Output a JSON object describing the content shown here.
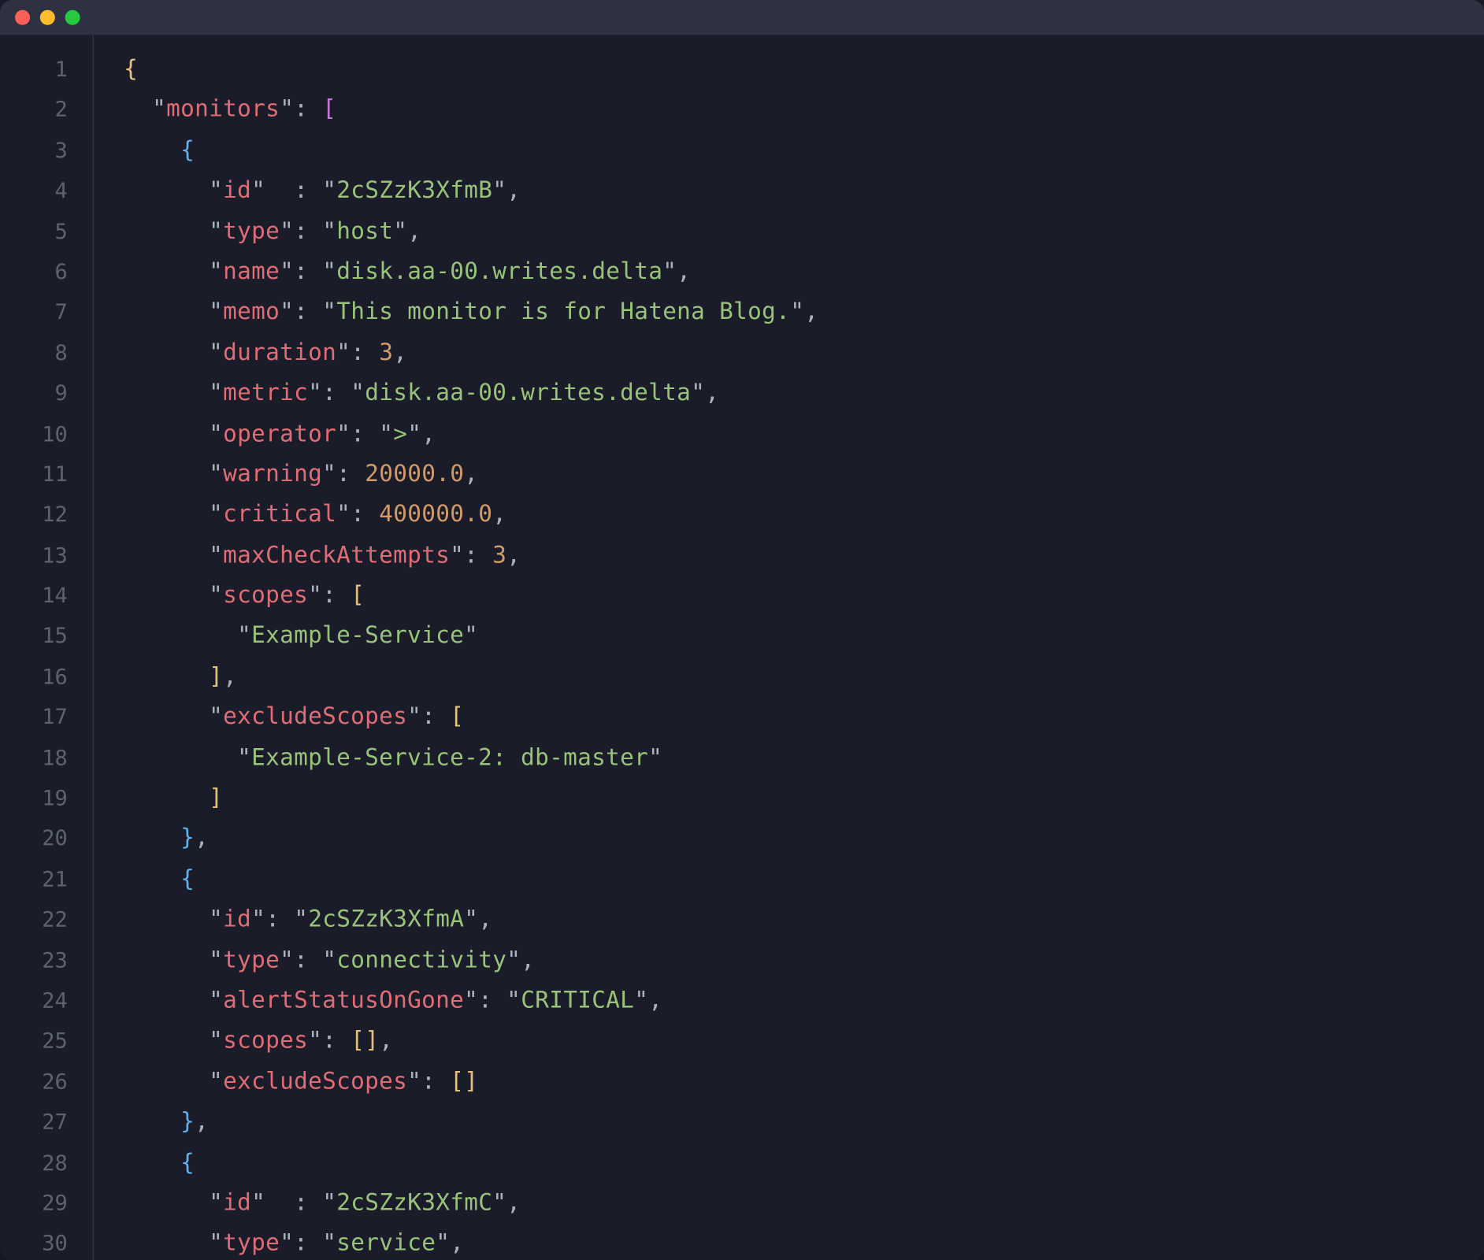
{
  "window": {
    "traffic": [
      "close",
      "minimize",
      "zoom"
    ]
  },
  "editor": {
    "lineStart": 1,
    "lineCount": 30
  },
  "tok": {
    "l1": [
      [
        "b1",
        "{"
      ]
    ],
    "l2": [
      [
        "p",
        "  "
      ],
      [
        "p",
        "\""
      ],
      [
        "k",
        "monitors"
      ],
      [
        "p",
        "\""
      ],
      [
        "p",
        ": "
      ],
      [
        "br",
        "["
      ]
    ],
    "l3": [
      [
        "p",
        "    "
      ],
      [
        "b2",
        "{"
      ]
    ],
    "l4": [
      [
        "p",
        "      "
      ],
      [
        "p",
        "\""
      ],
      [
        "k",
        "id"
      ],
      [
        "p",
        "\""
      ],
      [
        "p",
        "  : "
      ],
      [
        "p",
        "\""
      ],
      [
        "s",
        "2cSZzK3XfmB"
      ],
      [
        "p",
        "\""
      ],
      [
        "p",
        ","
      ]
    ],
    "l5": [
      [
        "p",
        "      "
      ],
      [
        "p",
        "\""
      ],
      [
        "k",
        "type"
      ],
      [
        "p",
        "\""
      ],
      [
        "p",
        ": "
      ],
      [
        "p",
        "\""
      ],
      [
        "s",
        "host"
      ],
      [
        "p",
        "\""
      ],
      [
        "p",
        ","
      ]
    ],
    "l6": [
      [
        "p",
        "      "
      ],
      [
        "p",
        "\""
      ],
      [
        "k",
        "name"
      ],
      [
        "p",
        "\""
      ],
      [
        "p",
        ": "
      ],
      [
        "p",
        "\""
      ],
      [
        "s",
        "disk.aa-00.writes.delta"
      ],
      [
        "p",
        "\""
      ],
      [
        "p",
        ","
      ]
    ],
    "l7": [
      [
        "p",
        "      "
      ],
      [
        "p",
        "\""
      ],
      [
        "k",
        "memo"
      ],
      [
        "p",
        "\""
      ],
      [
        "p",
        ": "
      ],
      [
        "p",
        "\""
      ],
      [
        "s",
        "This monitor is for Hatena Blog."
      ],
      [
        "p",
        "\""
      ],
      [
        "p",
        ","
      ]
    ],
    "l8": [
      [
        "p",
        "      "
      ],
      [
        "p",
        "\""
      ],
      [
        "k",
        "duration"
      ],
      [
        "p",
        "\""
      ],
      [
        "p",
        ": "
      ],
      [
        "n",
        "3"
      ],
      [
        "p",
        ","
      ]
    ],
    "l9": [
      [
        "p",
        "      "
      ],
      [
        "p",
        "\""
      ],
      [
        "k",
        "metric"
      ],
      [
        "p",
        "\""
      ],
      [
        "p",
        ": "
      ],
      [
        "p",
        "\""
      ],
      [
        "s",
        "disk.aa-00.writes.delta"
      ],
      [
        "p",
        "\""
      ],
      [
        "p",
        ","
      ]
    ],
    "l10": [
      [
        "p",
        "      "
      ],
      [
        "p",
        "\""
      ],
      [
        "k",
        "operator"
      ],
      [
        "p",
        "\""
      ],
      [
        "p",
        ": "
      ],
      [
        "p",
        "\""
      ],
      [
        "s",
        ">"
      ],
      [
        "p",
        "\""
      ],
      [
        "p",
        ","
      ]
    ],
    "l11": [
      [
        "p",
        "      "
      ],
      [
        "p",
        "\""
      ],
      [
        "k",
        "warning"
      ],
      [
        "p",
        "\""
      ],
      [
        "p",
        ": "
      ],
      [
        "n",
        "20000.0"
      ],
      [
        "p",
        ","
      ]
    ],
    "l12": [
      [
        "p",
        "      "
      ],
      [
        "p",
        "\""
      ],
      [
        "k",
        "critical"
      ],
      [
        "p",
        "\""
      ],
      [
        "p",
        ": "
      ],
      [
        "n",
        "400000.0"
      ],
      [
        "p",
        ","
      ]
    ],
    "l13": [
      [
        "p",
        "      "
      ],
      [
        "p",
        "\""
      ],
      [
        "k",
        "maxCheckAttempts"
      ],
      [
        "p",
        "\""
      ],
      [
        "p",
        ": "
      ],
      [
        "n",
        "3"
      ],
      [
        "p",
        ","
      ]
    ],
    "l14": [
      [
        "p",
        "      "
      ],
      [
        "p",
        "\""
      ],
      [
        "k",
        "scopes"
      ],
      [
        "p",
        "\""
      ],
      [
        "p",
        ": "
      ],
      [
        "b1",
        "["
      ]
    ],
    "l15": [
      [
        "p",
        "        "
      ],
      [
        "p",
        "\""
      ],
      [
        "s",
        "Example-Service"
      ],
      [
        "p",
        "\""
      ]
    ],
    "l16": [
      [
        "p",
        "      "
      ],
      [
        "b1",
        "]"
      ],
      [
        "p",
        ","
      ]
    ],
    "l17": [
      [
        "p",
        "      "
      ],
      [
        "p",
        "\""
      ],
      [
        "k",
        "excludeScopes"
      ],
      [
        "p",
        "\""
      ],
      [
        "p",
        ": "
      ],
      [
        "b1",
        "["
      ]
    ],
    "l18": [
      [
        "p",
        "        "
      ],
      [
        "p",
        "\""
      ],
      [
        "s",
        "Example-Service-2: db-master"
      ],
      [
        "p",
        "\""
      ]
    ],
    "l19": [
      [
        "p",
        "      "
      ],
      [
        "b1",
        "]"
      ]
    ],
    "l20": [
      [
        "p",
        "    "
      ],
      [
        "b2",
        "}"
      ],
      [
        "p",
        ","
      ]
    ],
    "l21": [
      [
        "p",
        "    "
      ],
      [
        "b2",
        "{"
      ]
    ],
    "l22": [
      [
        "p",
        "      "
      ],
      [
        "p",
        "\""
      ],
      [
        "k",
        "id"
      ],
      [
        "p",
        "\""
      ],
      [
        "p",
        ": "
      ],
      [
        "p",
        "\""
      ],
      [
        "s",
        "2cSZzK3XfmA"
      ],
      [
        "p",
        "\""
      ],
      [
        "p",
        ","
      ]
    ],
    "l23": [
      [
        "p",
        "      "
      ],
      [
        "p",
        "\""
      ],
      [
        "k",
        "type"
      ],
      [
        "p",
        "\""
      ],
      [
        "p",
        ": "
      ],
      [
        "p",
        "\""
      ],
      [
        "s",
        "connectivity"
      ],
      [
        "p",
        "\""
      ],
      [
        "p",
        ","
      ]
    ],
    "l24": [
      [
        "p",
        "      "
      ],
      [
        "p",
        "\""
      ],
      [
        "k",
        "alertStatusOnGone"
      ],
      [
        "p",
        "\""
      ],
      [
        "p",
        ": "
      ],
      [
        "p",
        "\""
      ],
      [
        "s",
        "CRITICAL"
      ],
      [
        "p",
        "\""
      ],
      [
        "p",
        ","
      ]
    ],
    "l25": [
      [
        "p",
        "      "
      ],
      [
        "p",
        "\""
      ],
      [
        "k",
        "scopes"
      ],
      [
        "p",
        "\""
      ],
      [
        "p",
        ": "
      ],
      [
        "b1",
        "[]"
      ],
      [
        "p",
        ","
      ]
    ],
    "l26": [
      [
        "p",
        "      "
      ],
      [
        "p",
        "\""
      ],
      [
        "k",
        "excludeScopes"
      ],
      [
        "p",
        "\""
      ],
      [
        "p",
        ": "
      ],
      [
        "b1",
        "[]"
      ]
    ],
    "l27": [
      [
        "p",
        "    "
      ],
      [
        "b2",
        "}"
      ],
      [
        "p",
        ","
      ]
    ],
    "l28": [
      [
        "p",
        "    "
      ],
      [
        "b2",
        "{"
      ]
    ],
    "l29": [
      [
        "p",
        "      "
      ],
      [
        "p",
        "\""
      ],
      [
        "k",
        "id"
      ],
      [
        "p",
        "\""
      ],
      [
        "p",
        "  : "
      ],
      [
        "p",
        "\""
      ],
      [
        "s",
        "2cSZzK3XfmC"
      ],
      [
        "p",
        "\""
      ],
      [
        "p",
        ","
      ]
    ],
    "l30": [
      [
        "p",
        "      "
      ],
      [
        "p",
        "\""
      ],
      [
        "k",
        "type"
      ],
      [
        "p",
        "\""
      ],
      [
        "p",
        ": "
      ],
      [
        "p",
        "\""
      ],
      [
        "s",
        "service"
      ],
      [
        "p",
        "\""
      ],
      [
        "p",
        ","
      ]
    ]
  }
}
